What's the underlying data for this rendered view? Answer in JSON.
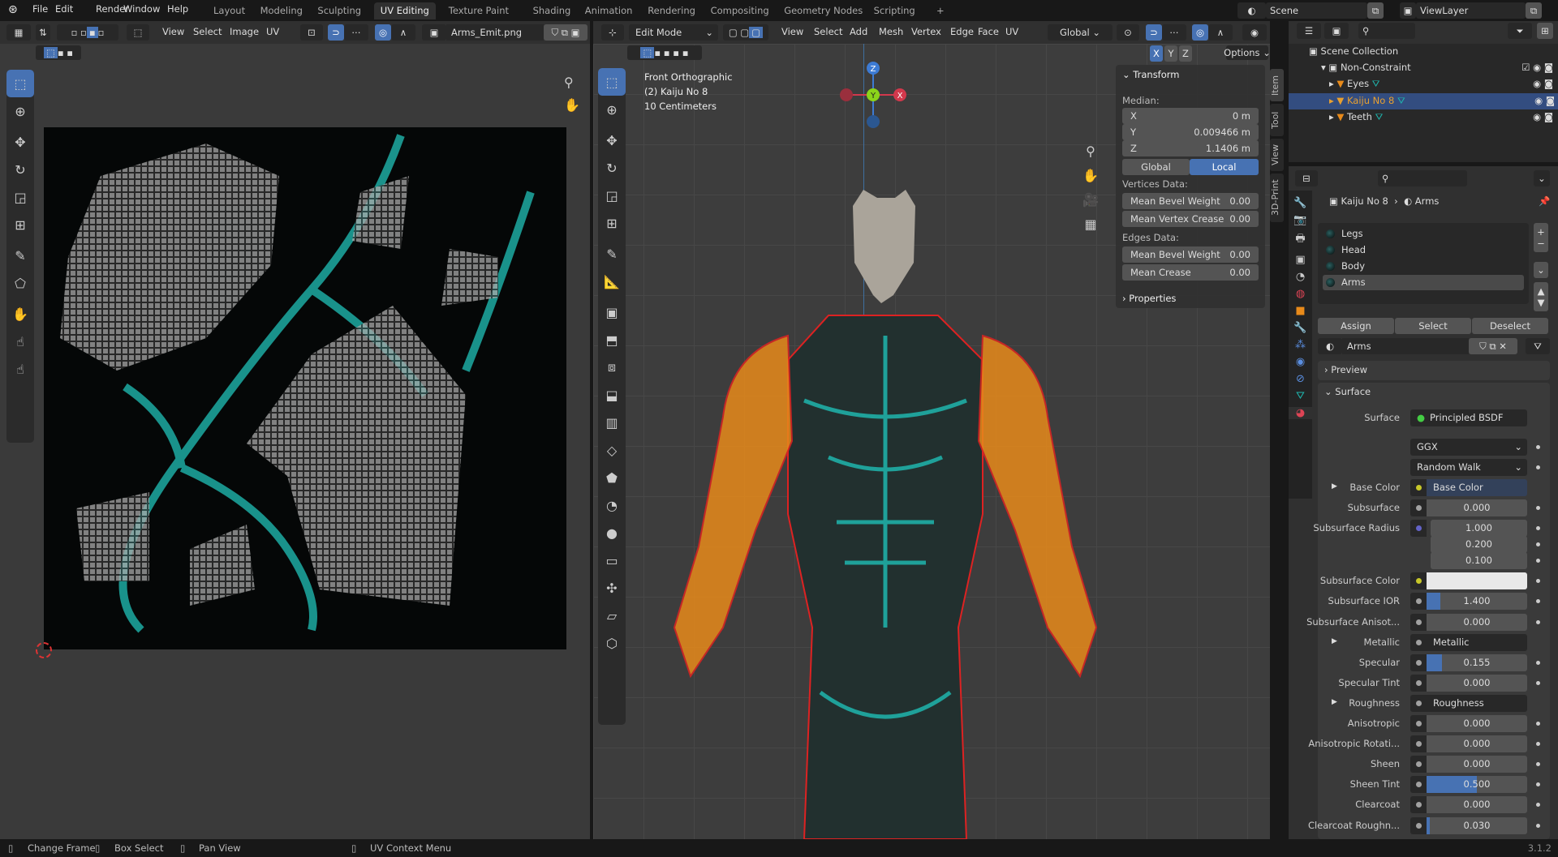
{
  "menu": [
    "File",
    "Edit",
    "Render",
    "Window",
    "Help"
  ],
  "workspaces": [
    "Layout",
    "Modeling",
    "Sculpting",
    "UV Editing",
    "Texture Paint",
    "Shading",
    "Animation",
    "Rendering",
    "Compositing",
    "Geometry Nodes",
    "Scripting",
    "+"
  ],
  "active_workspace": "UV Editing",
  "scene": "Scene",
  "view_layer": "ViewLayer",
  "uv_header": {
    "menus": [
      "View",
      "Select",
      "Image",
      "UV"
    ],
    "image_name": "Arms_Emit.png"
  },
  "viewport_header": {
    "mode": "Edit Mode",
    "menus": [
      "View",
      "Select",
      "Add",
      "Mesh",
      "Vertex",
      "Edge",
      "Face",
      "UV"
    ],
    "orientation": "Global",
    "axes": [
      "X",
      "Y",
      "Z"
    ],
    "options": "Options"
  },
  "viewport_info": {
    "view": "Front Orthographic",
    "object": "(2) Kaiju No 8",
    "scale": "10 Centimeters"
  },
  "gizmo": {
    "z": "Z",
    "y": "Y",
    "x": "X"
  },
  "npanel": {
    "transform": "Transform",
    "median": "Median:",
    "x_label": "X",
    "x": "0 m",
    "y_label": "Y",
    "y": "0.009466 m",
    "z_label": "Z",
    "z": "1.1406 m",
    "global": "Global",
    "local": "Local",
    "vertices_data": "Vertices Data:",
    "mean_bevel_weight": "Mean Bevel Weight",
    "mbw_v": "0.00",
    "mean_vertex_crease": "Mean Vertex Crease",
    "mvc_v": "0.00",
    "edges_data": "Edges Data:",
    "mean_bevel_weight_e": "Mean Bevel Weight",
    "mbwe_v": "0.00",
    "mean_crease": "Mean Crease",
    "mc_v": "0.00",
    "properties": "Properties"
  },
  "side_tabs": [
    "Item",
    "Tool",
    "View",
    "3D-Print"
  ],
  "outliner": {
    "scene_collection": "Scene Collection",
    "collection": "Non-Constraint",
    "objects": [
      "Eyes",
      "Kaiju No 8",
      "Teeth"
    ],
    "active": "Kaiju No 8"
  },
  "properties": {
    "object": "Kaiju No 8",
    "material": "Arms",
    "slots": [
      "Legs",
      "Head",
      "Body",
      "Arms"
    ],
    "active_slot": "Arms",
    "assign": "Assign",
    "select": "Select",
    "deselect": "Deselect",
    "material_name": "Arms",
    "preview": "Preview",
    "surface_panel": "Surface",
    "surface_label": "Surface",
    "surface_shader": "Principled BSDF",
    "distribution": "GGX",
    "subsurface_method": "Random Walk",
    "rows": [
      {
        "label": "Base Color",
        "link": "Base Color",
        "socket": "#c7c729",
        "expand": true
      },
      {
        "label": "Subsurface",
        "value": "0.000",
        "fill": 0,
        "socket": "#a1a1a1"
      },
      {
        "label": "Subsurface Radius",
        "value": "1.000",
        "socket": "#6363c7",
        "vector": [
          "1.000",
          "0.200",
          "0.100"
        ]
      },
      {
        "label": "Subsurface Color",
        "color": "#e8e8e8",
        "socket": "#c7c729"
      },
      {
        "label": "Subsurface IOR",
        "value": "1.400",
        "fill": 0.14,
        "socket": "#a1a1a1"
      },
      {
        "label": "Subsurface Anisot...",
        "value": "0.000",
        "fill": 0,
        "socket": "#a1a1a1"
      },
      {
        "label": "Metallic",
        "link": "Metallic",
        "socket": "#a1a1a1",
        "expand": true
      },
      {
        "label": "Specular",
        "value": "0.155",
        "fill": 0.155,
        "socket": "#a1a1a1"
      },
      {
        "label": "Specular Tint",
        "value": "0.000",
        "fill": 0,
        "socket": "#a1a1a1"
      },
      {
        "label": "Roughness",
        "link": "Roughness",
        "socket": "#a1a1a1",
        "expand": true
      },
      {
        "label": "Anisotropic",
        "value": "0.000",
        "fill": 0,
        "socket": "#a1a1a1"
      },
      {
        "label": "Anisotropic Rotati...",
        "value": "0.000",
        "fill": 0,
        "socket": "#a1a1a1"
      },
      {
        "label": "Sheen",
        "value": "0.000",
        "fill": 0,
        "socket": "#a1a1a1"
      },
      {
        "label": "Sheen Tint",
        "value": "0.500",
        "fill": 0.5,
        "socket": "#a1a1a1"
      },
      {
        "label": "Clearcoat",
        "value": "0.000",
        "fill": 0,
        "socket": "#a1a1a1"
      },
      {
        "label": "Clearcoat Roughn...",
        "value": "0.030",
        "fill": 0.03,
        "socket": "#a1a1a1"
      }
    ]
  },
  "status": {
    "change_frame": "Change Frame",
    "box_select": "Box Select",
    "pan_view": "Pan View",
    "uv_context": "UV Context Menu",
    "version": "3.1.2"
  },
  "colors": {
    "accent": "#4772b3",
    "teal": "#1fb5ad",
    "orange": "#e88a1a"
  }
}
